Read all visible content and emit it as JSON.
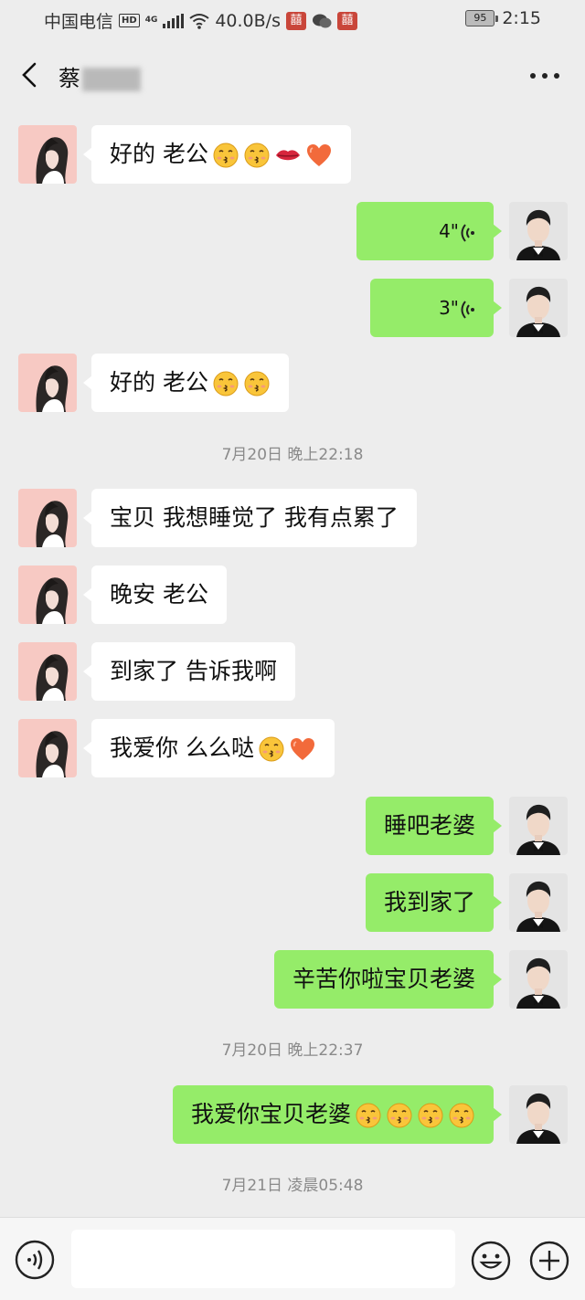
{
  "status_bar": {
    "carrier": "中国电信",
    "hd": "HD",
    "network": "4G",
    "speed": "40.0B/s",
    "battery": "95",
    "time": "2:15"
  },
  "header": {
    "title": "蔡"
  },
  "messages": [
    {
      "side": "in",
      "text": "好的 老公",
      "emojis": [
        "kiss-face",
        "kiss-face",
        "lips",
        "heart"
      ]
    },
    {
      "side": "out",
      "type": "voice",
      "duration": "4\""
    },
    {
      "side": "out",
      "type": "voice",
      "duration": "3\""
    },
    {
      "side": "in",
      "text": "好的 老公",
      "emojis": [
        "kiss-face",
        "kiss-face"
      ]
    },
    {
      "type": "timestamp",
      "text": "7月20日 晚上22:18"
    },
    {
      "side": "in",
      "text": "宝贝 我想睡觉了 我有点累了"
    },
    {
      "side": "in",
      "text": "晚安 老公"
    },
    {
      "side": "in",
      "text": "到家了 告诉我啊"
    },
    {
      "side": "in",
      "text": "我爱你 么么哒",
      "emojis": [
        "kiss-face",
        "heart"
      ]
    },
    {
      "side": "out",
      "text": "睡吧老婆"
    },
    {
      "side": "out",
      "text": "我到家了"
    },
    {
      "side": "out",
      "text": "辛苦你啦宝贝老婆"
    },
    {
      "type": "timestamp",
      "text": "7月20日 晚上22:37"
    },
    {
      "side": "out",
      "text": "我爱你宝贝老婆",
      "emojis": [
        "kiss-face",
        "kiss-face",
        "kiss-face",
        "kiss-face"
      ]
    },
    {
      "type": "timestamp",
      "text": "7月21日 凌晨05:48"
    }
  ],
  "input_bar": {
    "voice_icon": "voice-icon",
    "emoji_icon": "emoji-icon",
    "plus_icon": "plus-icon"
  },
  "colors": {
    "background": "#ededed",
    "outgoing_bubble": "#95ec69",
    "incoming_bubble": "#ffffff"
  }
}
